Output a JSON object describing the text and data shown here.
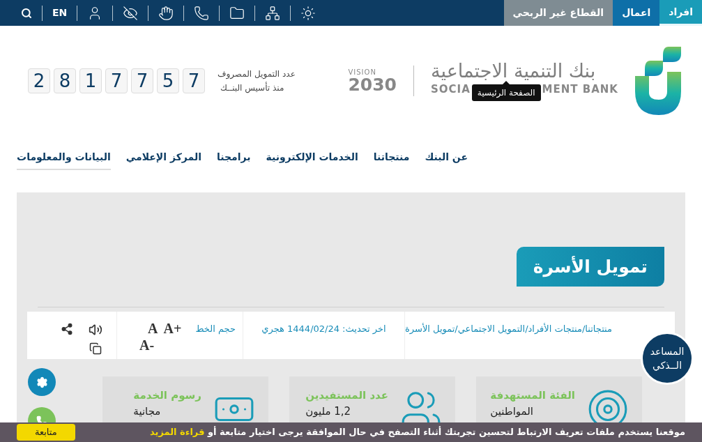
{
  "top_bar": {
    "segments": [
      {
        "label": "افراد",
        "selected": true
      },
      {
        "label": "اعمال",
        "selected": false
      },
      {
        "label": "القطاع غير الربحي",
        "selected": false
      }
    ],
    "language": "EN"
  },
  "logo": {
    "arabic": "بنك التنمية الاجتماعية",
    "english_left": "SOCIA",
    "english_right": "MENT BANK",
    "tooltip": "الصفحة الرئيسية"
  },
  "vision": {
    "word": "VISION",
    "year": "2030"
  },
  "counter": {
    "label_1": "عدد التمويل المصروف",
    "label_2": "منذ تأسيس البنــك",
    "digits": [
      "7",
      "5",
      "7",
      "7",
      "1",
      "8",
      "2"
    ]
  },
  "nav": [
    {
      "label": "عن البنك",
      "selected": false
    },
    {
      "label": "منتجاتنا",
      "selected": false
    },
    {
      "label": "الخدمات الإلكترونية",
      "selected": false
    },
    {
      "label": "برامجنا",
      "selected": false
    },
    {
      "label": "المركز الإعلامي",
      "selected": false
    },
    {
      "label": "البيانات والمعلومات",
      "selected": true
    }
  ],
  "page_title": "تمويل الأسرة",
  "info_bar": {
    "breadcrumb": [
      "منتجاتنا",
      "منتجات الأفراد",
      "التمويل الاجتماعي",
      "تمويل الأسرة"
    ],
    "separator": "/",
    "updated": "اخر تحديث: 1444/02/24 هجري",
    "font_size_label": "حجم الخط",
    "font_larger": "A+",
    "font_normal": "A",
    "font_smaller": "A-"
  },
  "assistant": {
    "line_1": "المساعد",
    "line_2": "الــذكي"
  },
  "cards": [
    {
      "kind": "target",
      "title": "الفئة المستهدفة",
      "value": "المواطنين"
    },
    {
      "kind": "people",
      "title": "عدد المستفيدين",
      "value": "1,2 مليون"
    },
    {
      "kind": "money",
      "title": "رسوم الخدمة",
      "value": "مجانية"
    }
  ],
  "cookie": {
    "text": "موقعنا يستخدم ملفات تعريف الارتباط لتحسين تجربتك أثناء التصفح في حال الموافقة يرجى اختيار متابعة أو",
    "link": "قراءة المزيد",
    "button": "متابعة"
  }
}
